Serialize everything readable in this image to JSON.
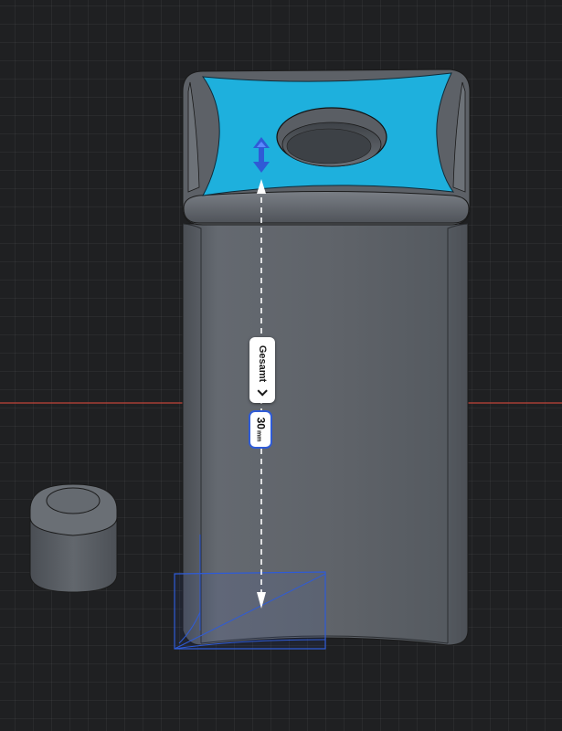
{
  "viewport": {
    "background": "#1f2022",
    "grid_color": "#2a2b2e",
    "x_axis_color": "#c0443a"
  },
  "model": {
    "body_color": "#5e6268",
    "selected_face_color": "#1eb0dd",
    "selection_box_color": "#2f5bd6"
  },
  "dimension": {
    "mode_label": "Gesamt",
    "mode_icon": "chevron-down-icon",
    "value": "30",
    "unit": "mm",
    "drag_handle_icon": "double-arrow-vertical-icon",
    "arrow_color": "#ffffff"
  }
}
